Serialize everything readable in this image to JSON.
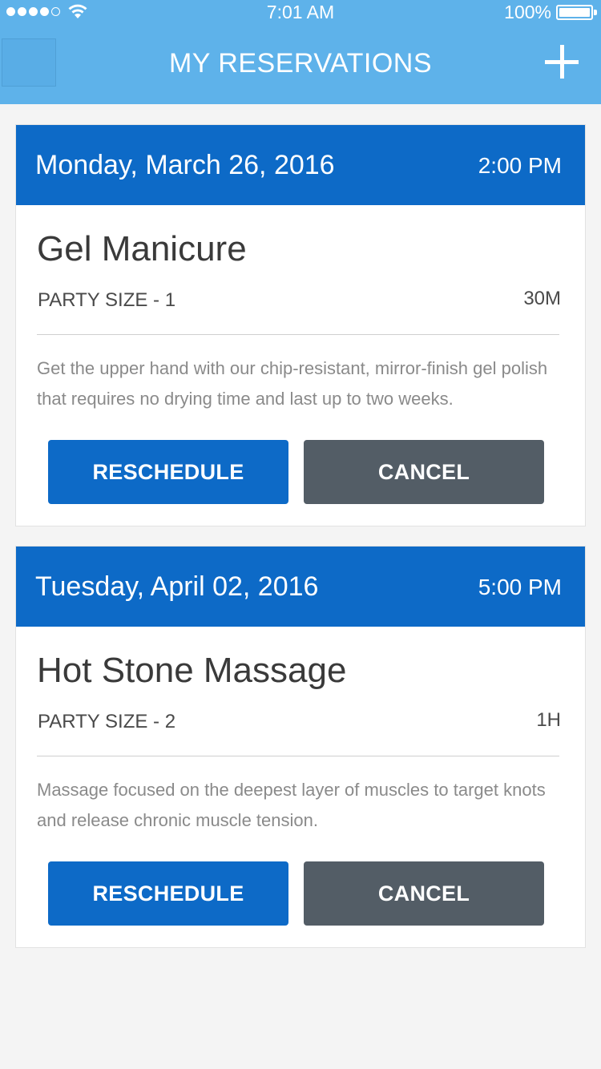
{
  "status_bar": {
    "time": "7:01 AM",
    "battery_percent": "100%",
    "signal_bars_filled": 4,
    "signal_bars_total": 5
  },
  "nav": {
    "title": "MY RESERVATIONS",
    "add_icon": "plus-icon"
  },
  "reservations": [
    {
      "date": "Monday, March 26, 2016",
      "time": "2:00 PM",
      "service": "Gel Manicure",
      "party_size": "PARTY SIZE - 1",
      "duration": "30M",
      "description": "Get the upper hand with our chip-resistant, mirror-finish gel polish that requires no drying time and last up to two weeks.",
      "reschedule_label": "RESCHEDULE",
      "cancel_label": "CANCEL"
    },
    {
      "date": "Tuesday, April 02, 2016",
      "time": "5:00 PM",
      "service": "Hot Stone Massage",
      "party_size": "PARTY SIZE - 2",
      "duration": "1H",
      "description": "Massage focused on the deepest layer of muscles to target knots and release chronic muscle tension.",
      "reschedule_label": "RESCHEDULE",
      "cancel_label": "CANCEL"
    }
  ],
  "colors": {
    "nav_bg": "#5eb2ea",
    "card_header_bg": "#0d6ac7",
    "reschedule_bg": "#0d6ac7",
    "cancel_bg": "#535d66"
  }
}
